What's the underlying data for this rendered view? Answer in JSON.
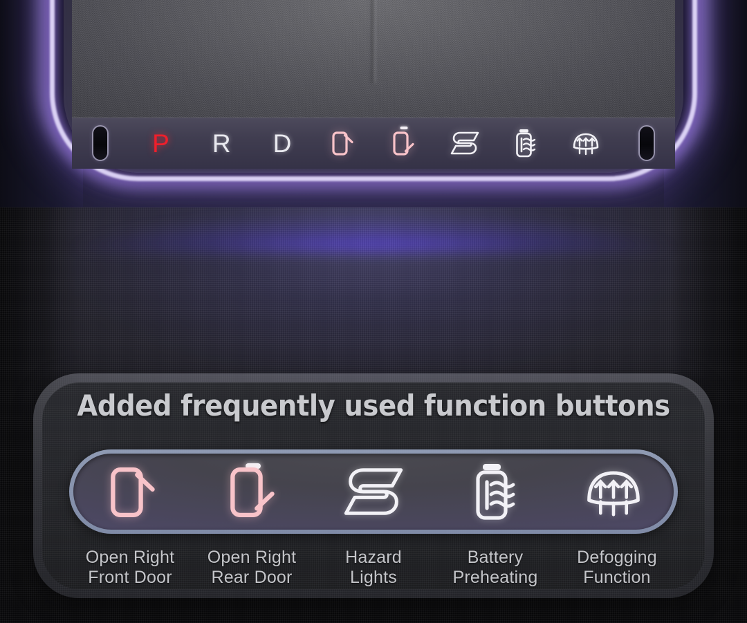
{
  "scene": {
    "name": "ev-center-console",
    "accent_ambient": "#a87eff",
    "accent_active_gear": "#ef1f2b",
    "accent_door_icon": "#f8c3c9",
    "accent_icon": "#f2f1f6",
    "card_border": "#a8b6d4"
  },
  "gear_strip": {
    "name": "gear-selector-strip",
    "left_endcap": "endcap-button",
    "right_endcap": "endcap-button",
    "separator_dash": "-",
    "items": [
      {
        "key": "park",
        "label": "P",
        "type": "letter",
        "active": true,
        "icon": "park-letter"
      },
      {
        "key": "reverse",
        "label": "R",
        "type": "letter",
        "active": false,
        "icon": "reverse-letter"
      },
      {
        "key": "drive",
        "label": "D",
        "type": "letter",
        "active": false,
        "icon": "drive-letter"
      },
      {
        "key": "open_right_front",
        "label": "",
        "type": "icon",
        "active": false,
        "icon": "door-front-open-icon"
      },
      {
        "key": "open_right_rear",
        "label": "",
        "type": "icon",
        "active": false,
        "icon": "door-rear-open-icon"
      },
      {
        "key": "hazard_lights",
        "label": "",
        "type": "icon",
        "active": false,
        "icon": "hazard-s-icon"
      },
      {
        "key": "battery_preheat",
        "label": "",
        "type": "icon",
        "active": false,
        "icon": "battery-preheat-icon"
      },
      {
        "key": "defogging",
        "label": "",
        "type": "icon",
        "active": false,
        "icon": "defogger-icon"
      }
    ]
  },
  "callout": {
    "headline": "Added frequently used function buttons",
    "buttons": [
      {
        "key": "open_right_front",
        "icon": "door-front-open-icon",
        "label_line1": "Open Right",
        "label_line2": "Front Door"
      },
      {
        "key": "open_right_rear",
        "icon": "door-rear-open-icon",
        "label_line1": "Open Right",
        "label_line2": "Rear Door"
      },
      {
        "key": "hazard_lights",
        "icon": "hazard-s-icon",
        "label_line1": "Hazard",
        "label_line2": "Lights"
      },
      {
        "key": "battery_preheat",
        "icon": "battery-preheat-icon",
        "label_line1": "Battery",
        "label_line2": "Preheating"
      },
      {
        "key": "defogging",
        "icon": "defogger-icon",
        "label_line1": "Defogging",
        "label_line2": "Function"
      }
    ],
    "separator_dash": "-"
  }
}
